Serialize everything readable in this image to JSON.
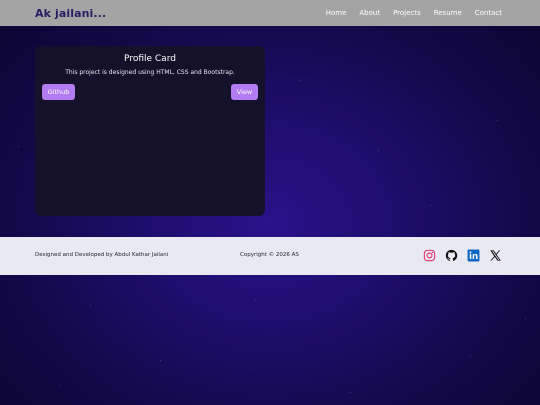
{
  "navbar": {
    "brand": "Ak jailani...",
    "links": [
      "Home",
      "About",
      "Projects",
      "Resume",
      "Contact"
    ]
  },
  "card": {
    "title": "Profile Card",
    "description": "This project is designed using HTML, CSS and Bootstrap.",
    "github_label": "Github",
    "view_label": "View"
  },
  "footer": {
    "designed_by": "Designed and Developed by Abdul Kathar Jailani",
    "copyright": "Copyright © 2026 AS",
    "social_icons": [
      "instagram-icon",
      "github-icon",
      "linkedin-icon",
      "x-icon"
    ]
  },
  "colors": {
    "navbar_bg": "#a4a4a4",
    "brand": "#2b1d63",
    "card_bg": "#16112b",
    "button_bg": "#b27cf0",
    "footer_bg": "#e9e9f3",
    "page_bg": "#1d0d6a"
  }
}
